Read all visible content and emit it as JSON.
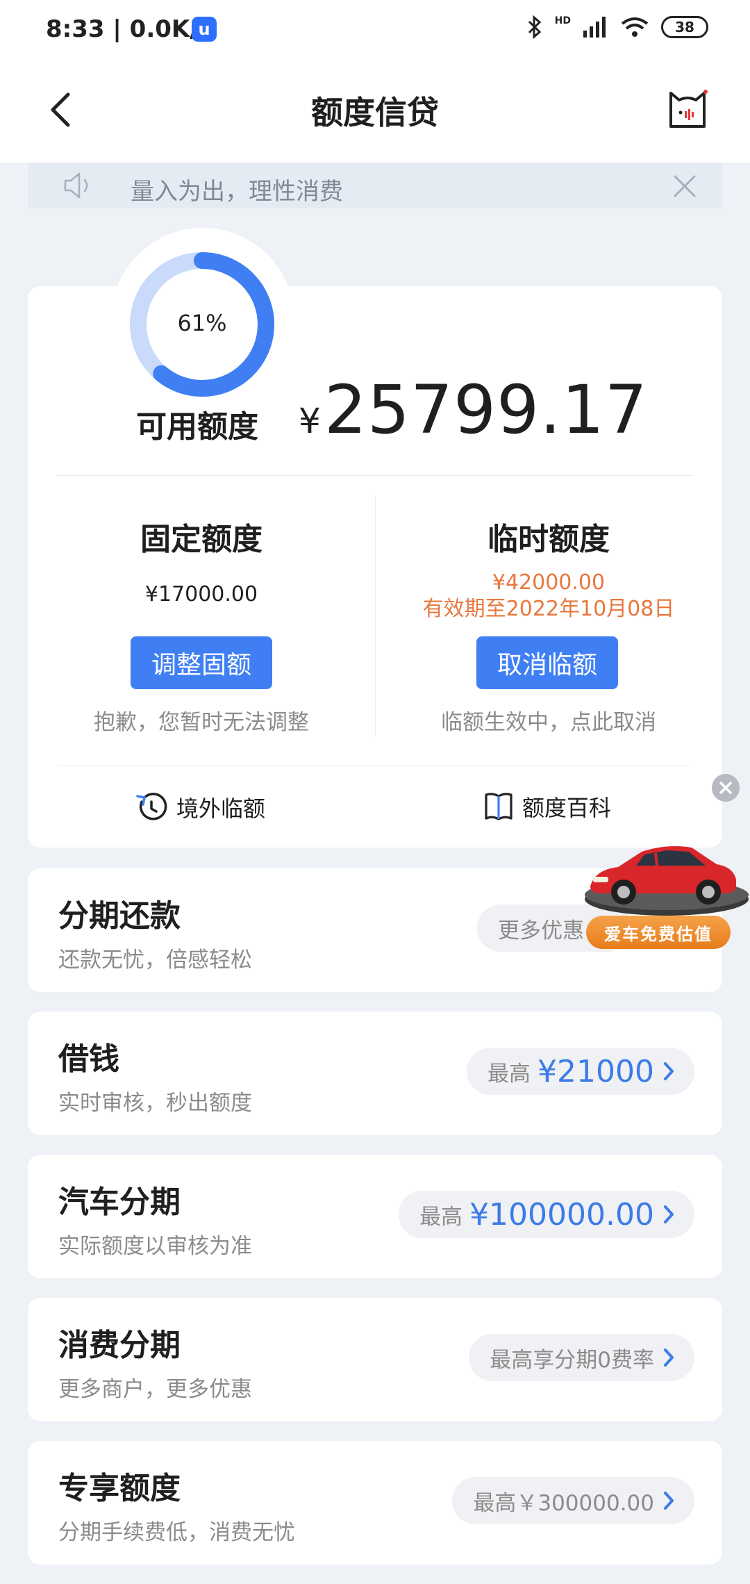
{
  "status_bar": {
    "time": "8:33 | 0.0K/s",
    "app_badge": "u",
    "hd_label": "HD",
    "battery": "38"
  },
  "nav": {
    "title": "额度信贷"
  },
  "notice": {
    "text": "量入为出，理性消费"
  },
  "credit": {
    "usage_percent": 61,
    "usage_label": "61%",
    "available_label": "可用额度",
    "currency": "¥",
    "available_amount": "25799.17",
    "fixed": {
      "title": "固定额度",
      "amount": "¥17000.00",
      "button": "调整固额",
      "hint": "抱歉，您暂时无法调整"
    },
    "temporary": {
      "title": "临时额度",
      "amount": "¥42000.00",
      "validity": "有效期至2022年10月08日",
      "button": "取消临额",
      "hint": "临额生效中，点此取消"
    },
    "links": {
      "overseas": "境外临额",
      "encyclopedia": "额度百科"
    }
  },
  "services": [
    {
      "title": "分期还款",
      "subtitle": "还款无忧，倍感轻松",
      "pill_prefix": "更多优惠 戳",
      "pill_value": ""
    },
    {
      "title": "借钱",
      "subtitle": "实时审核，秒出额度",
      "pill_prefix": "最高",
      "pill_value": "¥21000"
    },
    {
      "title": "汽车分期",
      "subtitle": "实际额度以审核为准",
      "pill_prefix": "最高",
      "pill_value": "¥100000.00"
    },
    {
      "title": "消费分期",
      "subtitle": "更多商户，更多优惠",
      "pill_prefix": "最高享分期0费率",
      "pill_value": ""
    },
    {
      "title": "专享额度",
      "subtitle": "分期手续费低，消费无忧",
      "pill_prefix": "最高￥300000.00",
      "pill_value": ""
    }
  ],
  "float_ad": {
    "label": "爱车免费估值"
  },
  "colors": {
    "accent_blue": "#3f7ff3",
    "value_blue": "#3c7be8",
    "orange": "#e8773c",
    "ring_light": "#c9dafb"
  }
}
